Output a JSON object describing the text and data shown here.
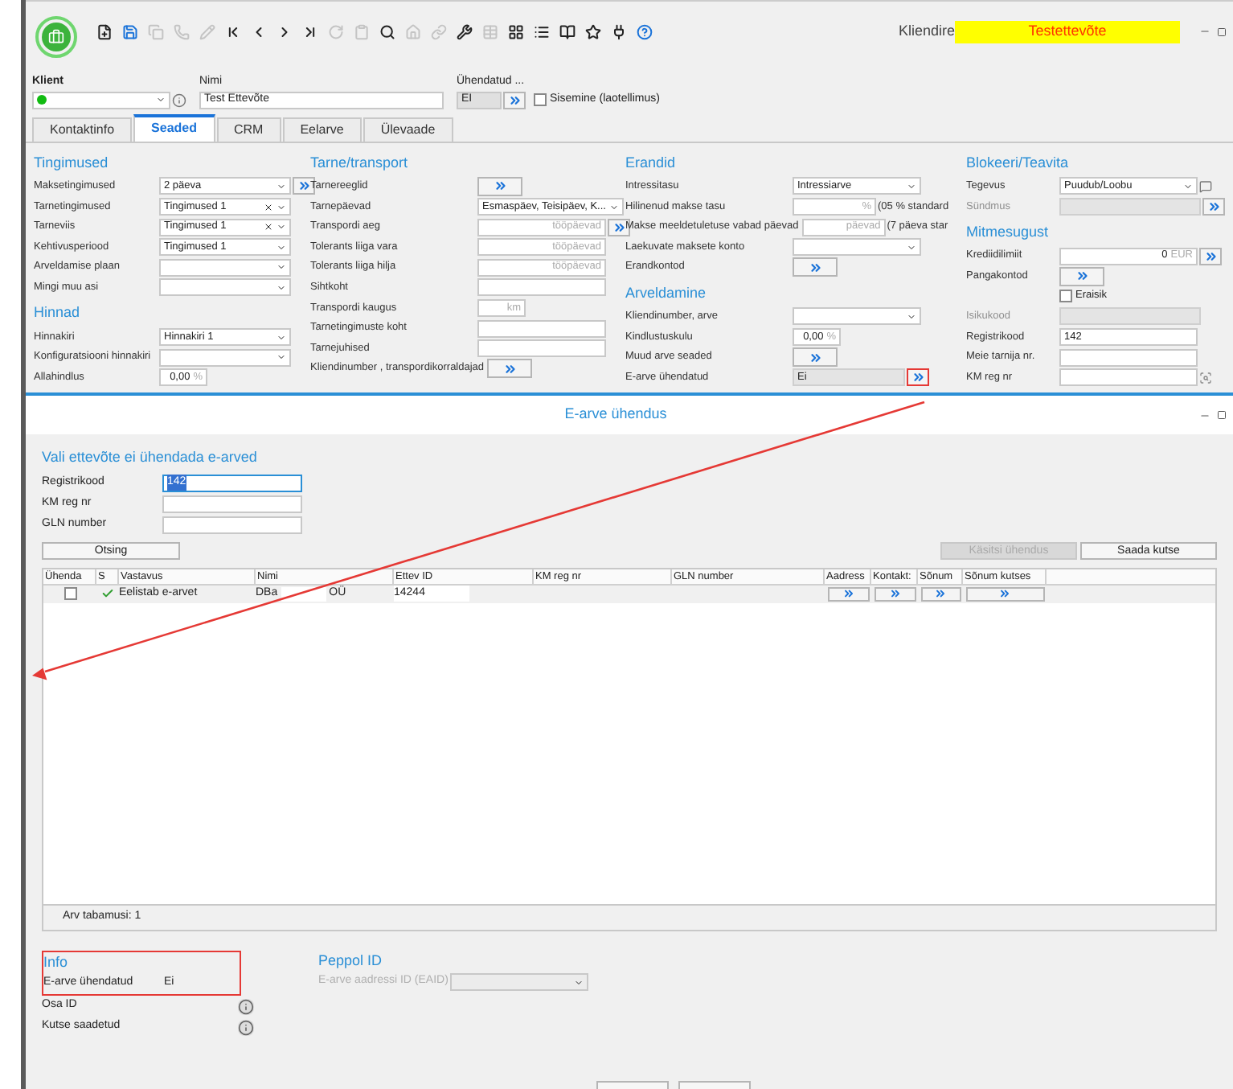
{
  "title": {
    "prefix": "Kliendire",
    "highlight": "Testettevõte"
  },
  "toolbar": [
    {
      "kind": "new",
      "disabled": false
    },
    {
      "kind": "save",
      "disabled": false
    },
    {
      "kind": "copy",
      "disabled": true
    },
    {
      "kind": "phone",
      "disabled": true
    },
    {
      "kind": "pen",
      "disabled": true
    },
    {
      "kind": "first",
      "disabled": false
    },
    {
      "kind": "prev",
      "disabled": false
    },
    {
      "kind": "next",
      "disabled": false
    },
    {
      "kind": "last",
      "disabled": false
    },
    {
      "kind": "redo",
      "disabled": true
    },
    {
      "kind": "clip",
      "disabled": true
    },
    {
      "kind": "search",
      "disabled": false
    },
    {
      "kind": "home",
      "disabled": true
    },
    {
      "kind": "link",
      "disabled": true
    },
    {
      "kind": "tool",
      "disabled": false
    },
    {
      "kind": "grid",
      "disabled": true
    },
    {
      "kind": "palette",
      "disabled": false
    },
    {
      "kind": "list",
      "disabled": false
    },
    {
      "kind": "book",
      "disabled": false
    },
    {
      "kind": "star",
      "disabled": false
    },
    {
      "kind": "plug",
      "disabled": false
    },
    {
      "kind": "help",
      "disabled": false
    }
  ],
  "client": {
    "klient_label": "Klient",
    "status_dot": {
      "color": "#11bb11"
    },
    "nimi_label": "Nimi",
    "nimi": "Test Ettevõte",
    "uhendatud_label": "Ühendatud ...",
    "uhendatud": "EI",
    "sisemine": {
      "label": "Sisemine (laotellimus)",
      "checked": false
    }
  },
  "tabs": [
    {
      "label": "Kontaktinfo",
      "selected": false
    },
    {
      "label": "Seaded",
      "selected": true
    },
    {
      "label": "CRM",
      "selected": false
    },
    {
      "label": "Eelarve",
      "selected": false
    },
    {
      "label": "Ülevaade",
      "selected": false
    }
  ],
  "columns": [
    {
      "sections": [
        {
          "title": "Tingimused",
          "rows": [
            {
              "label": "Maksetingimused",
              "kind": "select",
              "value": "2 päeva",
              "action": true
            },
            {
              "label": "Tarnetingimused",
              "kind": "select",
              "value": "Tingimused 1",
              "clearable": true
            },
            {
              "label": "Tarneviis",
              "kind": "select",
              "value": "Tingimused 1",
              "clearable": true
            },
            {
              "label": "Kehtivusperiood",
              "kind": "select",
              "value": "Tingimused 1"
            },
            {
              "label": "Arveldamise plaan",
              "kind": "select"
            },
            {
              "label": "Mingi muu asi",
              "kind": "select"
            }
          ]
        },
        {
          "title": "Hinnad",
          "rows": [
            {
              "label": "Hinnakiri",
              "kind": "select",
              "value": "Hinnakiri 1"
            },
            {
              "label": "Konfiguratsiooni hinnakiri",
              "kind": "select"
            },
            {
              "label": "Allahindlus",
              "kind": "input",
              "value": "0,00",
              "unit": "%",
              "narrow": true
            }
          ]
        }
      ]
    },
    {
      "sections": [
        {
          "title": "Tarne/transport",
          "rows": [
            {
              "label": "Tarnereeglid",
              "kind": "action"
            },
            {
              "label": "Tarnepäevad",
              "kind": "select",
              "value": "Esmaspäev, Teisipäev, K..."
            },
            {
              "label": "Transpordi aeg",
              "kind": "input",
              "unit": "tööpäevad",
              "action": true
            },
            {
              "label": "Tolerants liiga vara",
              "kind": "input",
              "unit": "tööpäevad"
            },
            {
              "label": "Tolerants liiga hilja",
              "kind": "input",
              "unit": "tööpäevad"
            },
            {
              "label": "Sihtkoht",
              "kind": "input"
            },
            {
              "label": "Transpordi kaugus",
              "kind": "input",
              "unit": "km",
              "narrow": true
            },
            {
              "label": "Tarnetingimuste koht",
              "kind": "input"
            },
            {
              "label": "Tarnejuhised",
              "kind": "input"
            },
            {
              "label": "Kliendinumber , transpordikorraldajad",
              "kind": "action"
            }
          ]
        }
      ]
    },
    {
      "sections": [
        {
          "title": "Erandid",
          "rows": [
            {
              "label": "Intressitasu",
              "kind": "select",
              "value": "Intressiarve"
            },
            {
              "label": "Hilinenud makse tasu",
              "kind": "input",
              "unit": "%",
              "note": "(05 % standard"
            },
            {
              "label": "Makse meeldetuletuse vabad päevad",
              "kind": "input",
              "unit": "päevad",
              "note": "(7 päeva star"
            },
            {
              "label": "Laekuvate maksete konto",
              "kind": "select"
            },
            {
              "label": "Erandkontod",
              "kind": "action"
            }
          ]
        },
        {
          "title": "Arveldamine",
          "rows": [
            {
              "label": "Kliendinumber, arve",
              "kind": "select"
            },
            {
              "label": "Kindlustuskulu",
              "kind": "input",
              "value": "0,00",
              "unit": "%",
              "narrow": true
            },
            {
              "label": "Muud arve seaded",
              "kind": "action"
            },
            {
              "label": "E-arve ühendatud",
              "kind": "readonly",
              "value": "Ei",
              "action": true,
              "highlighted": true
            }
          ]
        }
      ]
    },
    {
      "sections": [
        {
          "title": "Blokeeri/Teavita",
          "rows": [
            {
              "label": "Tegevus",
              "kind": "select",
              "value": "Puudub/Loobu",
              "comment": true
            },
            {
              "label": "Sündmus",
              "kind": "readonly",
              "action": true,
              "disabled": true
            }
          ]
        },
        {
          "title": "Mitmesugust",
          "rows": [
            {
              "label": "Krediidilimiit",
              "kind": "input",
              "value": "0",
              "unit": "EUR",
              "action": true
            },
            {
              "label": "Pangakontod",
              "kind": "action"
            },
            {
              "label": "Eraisik",
              "kind": "check",
              "checked": false
            },
            {
              "label": "Isikukood",
              "kind": "readonly",
              "disabled": true
            },
            {
              "label": "Registrikood",
              "kind": "input",
              "value": "142"
            },
            {
              "label": "Meie tarnija nr.",
              "kind": "input"
            },
            {
              "label": "KM reg nr",
              "kind": "input",
              "lookup": true
            }
          ]
        }
      ]
    }
  ],
  "dialog": {
    "title": "E-arve ühendus",
    "heading": "Vali ettevõte ei ühendada e-arved",
    "fields": [
      {
        "label": "Registrikood",
        "value": "142",
        "focused": true
      },
      {
        "label": "KM reg nr",
        "focused": false
      },
      {
        "label": "GLN number",
        "focused": false
      }
    ],
    "buttons": [
      {
        "label": "Otsing",
        "disabled": false
      },
      {
        "label": "Käsitsi ühendus",
        "disabled": true
      },
      {
        "label": "Saada kutse",
        "disabled": false
      }
    ],
    "table": {
      "columns": [
        "Ühenda",
        "S",
        "Vastavus",
        "Nimi",
        "Ettev ID",
        "KM reg nr",
        "GLN number",
        "Aadress",
        "Kontakt:",
        "Sõnum",
        "Sõnum kutses"
      ],
      "rows": [
        {
          "uhenda": false,
          "ok": true,
          "vastavus": "Eelistab e-arvet",
          "nimi_start": "DBa",
          "nimi_end": "OÜ",
          "ettev_id": "14244"
        }
      ]
    },
    "footer": "Arv tabamusi: 1",
    "info": {
      "title": "Info",
      "highlighted": true,
      "rows": [
        {
          "label": "E-arve ühendatud",
          "kind": "text",
          "value": "Ei"
        },
        {
          "label": "Osa ID",
          "kind": "info"
        },
        {
          "label": "Kutse saadetud",
          "kind": "info"
        }
      ]
    },
    "peppol": {
      "title": "Peppol ID",
      "label": "E-arve aadressi ID (EAID)",
      "disabled": true
    }
  }
}
